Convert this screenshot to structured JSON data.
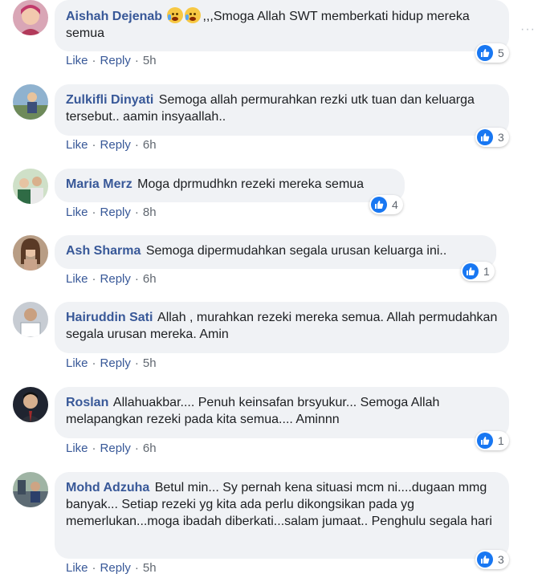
{
  "labels": {
    "like": "Like",
    "reply": "Reply",
    "dot": "·"
  },
  "more_icon": "···",
  "comments": [
    {
      "author": "Aishah Dejenab",
      "emoji": "crying-face-icon x2",
      "text": ",,,Smoga Allah SWT memberkati hidup mereka semua",
      "time": "5h",
      "reactions": "5"
    },
    {
      "author": "Zulkifli Dinyati",
      "text": "Semoga allah permurahkan rezki utk tuan dan keluarga tersebut.. aamin insyaallah..",
      "time": "6h",
      "reactions": "3"
    },
    {
      "author": "Maria Merz",
      "text": "Moga dprmudhkn rezeki mereka semua",
      "time": "8h",
      "reactions": "4"
    },
    {
      "author": "Ash Sharma",
      "text": "Semoga dipermudahkan segala urusan keluarga ini..",
      "time": "6h",
      "reactions": "1"
    },
    {
      "author": "Hairuddin Sati",
      "text": "Allah , murahkan rezeki mereka semua. Allah permudahkan segala urusan mereka. Amin",
      "time": "5h",
      "reactions": ""
    },
    {
      "author": "Roslan",
      "text": "Allahuakbar.... Penuh keinsafan brsyukur... Semoga Allah melapangkan rezeki pada kita semua.... Aminnn",
      "time": "6h",
      "reactions": "1"
    },
    {
      "author": "Mohd Adzuha",
      "text": "Betul min... Sy pernah kena situasi mcm ni....dugaan mmg banyak... Setiap rezeki yg kita ada perlu dikongsikan pada yg memerlukan...moga ibadah diberkati...salam jumaat.. Penghulu segala hari",
      "time": "5h",
      "reactions": "3"
    }
  ],
  "colors": {
    "author": "#385898",
    "bubble": "#f0f2f5",
    "like_badge": "#1877f2"
  }
}
